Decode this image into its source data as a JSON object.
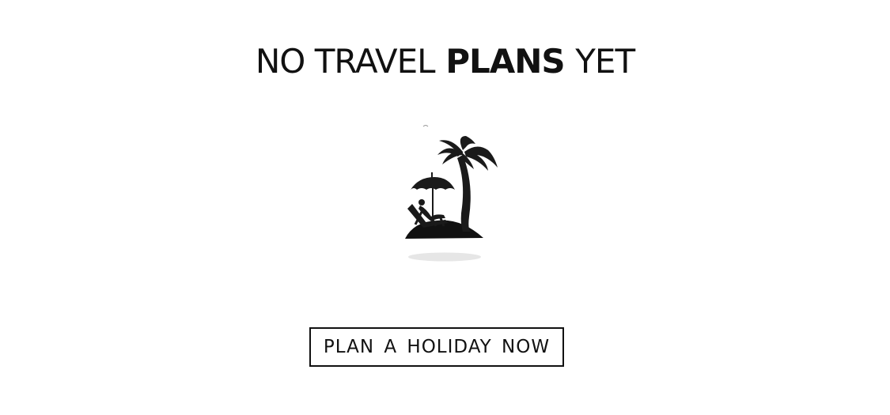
{
  "empty_state": {
    "title": {
      "part1": "NO TRAVEL",
      "part2": "PLANS",
      "part3": "YET"
    },
    "illustration_icon": "island-palm-beach-chair-icon",
    "cta_label": "PLAN A HOLIDAY NOW"
  },
  "colors": {
    "text": "#111111",
    "background": "#ffffff",
    "shadow": "#e6e6e6"
  }
}
